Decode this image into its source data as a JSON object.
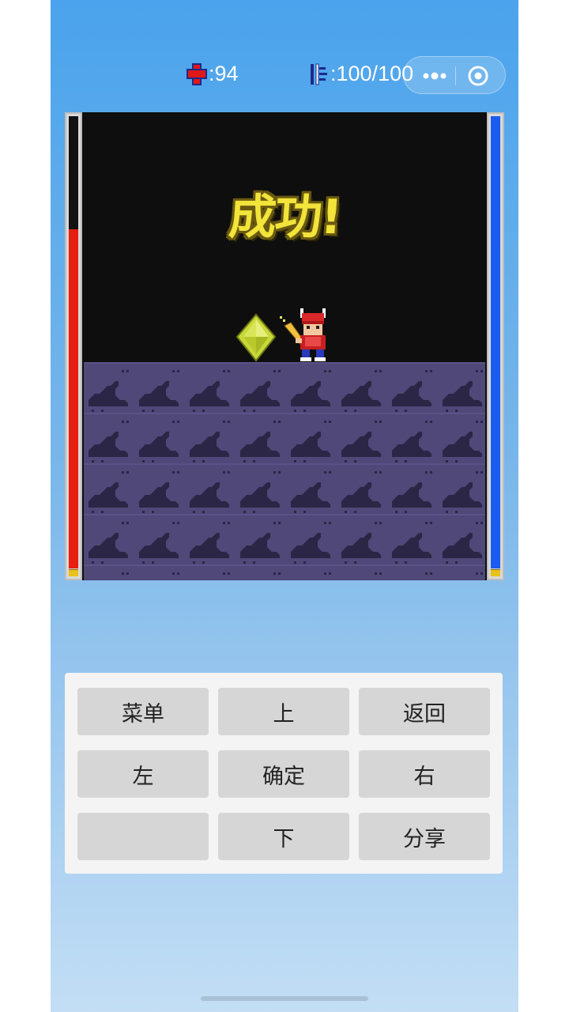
{
  "hud": {
    "hp_icon": "red-cross-icon",
    "hp_text": ":94",
    "mp_icon": "sword-gauge-icon",
    "mp_text": ":100/100"
  },
  "capsule": {
    "more_icon": "more-dots-icon",
    "close_icon": "target-circle-icon"
  },
  "game": {
    "banner": "成功!",
    "hp_level": 0.75,
    "mp_level": 1.0,
    "colors": {
      "hp_bar": "#e81e10",
      "mp_bar": "#1a5cf0",
      "ground": "#4f4878",
      "ground_pattern": "#2b2646",
      "banner_text": "#f2e43a"
    }
  },
  "controls": {
    "menu": "菜单",
    "up": "上",
    "back": "返回",
    "left": "左",
    "ok": "确定",
    "right": "右",
    "blank": "",
    "down": "下",
    "share": "分享"
  }
}
